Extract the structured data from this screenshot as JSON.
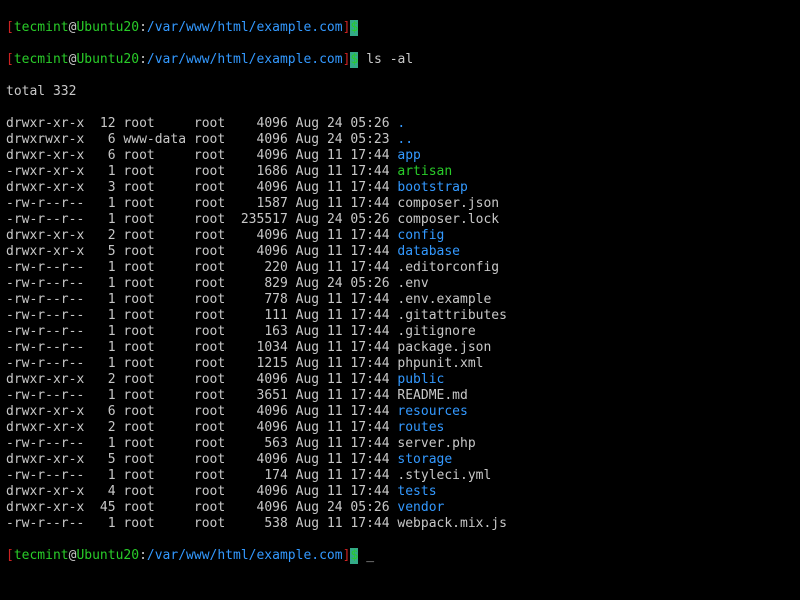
{
  "prompt": {
    "bracket_open": "[",
    "bracket_close": "]",
    "user": "tecmint",
    "at": "@",
    "host": "Ubuntu20",
    "colon": ":",
    "path": "/var/www/html/example.com",
    "dollar": "$"
  },
  "command": "ls -al",
  "total_line": "total 332",
  "files": [
    {
      "perm": "drwxr-xr-x",
      "links": "12",
      "owner": "root",
      "group": "root",
      "size": "4096",
      "date": "Aug 24 05:26",
      "name": ".",
      "cls": "dir"
    },
    {
      "perm": "drwxrwxr-x",
      "links": "6",
      "owner": "www-data",
      "group": "root",
      "size": "4096",
      "date": "Aug 24 05:23",
      "name": "..",
      "cls": "dir"
    },
    {
      "perm": "drwxr-xr-x",
      "links": "6",
      "owner": "root",
      "group": "root",
      "size": "4096",
      "date": "Aug 11 17:44",
      "name": "app",
      "cls": "dir"
    },
    {
      "perm": "-rwxr-xr-x",
      "links": "1",
      "owner": "root",
      "group": "root",
      "size": "1686",
      "date": "Aug 11 17:44",
      "name": "artisan",
      "cls": "exec"
    },
    {
      "perm": "drwxr-xr-x",
      "links": "3",
      "owner": "root",
      "group": "root",
      "size": "4096",
      "date": "Aug 11 17:44",
      "name": "bootstrap",
      "cls": "dir"
    },
    {
      "perm": "-rw-r--r--",
      "links": "1",
      "owner": "root",
      "group": "root",
      "size": "1587",
      "date": "Aug 11 17:44",
      "name": "composer.json",
      "cls": "plain"
    },
    {
      "perm": "-rw-r--r--",
      "links": "1",
      "owner": "root",
      "group": "root",
      "size": "235517",
      "date": "Aug 24 05:26",
      "name": "composer.lock",
      "cls": "plain"
    },
    {
      "perm": "drwxr-xr-x",
      "links": "2",
      "owner": "root",
      "group": "root",
      "size": "4096",
      "date": "Aug 11 17:44",
      "name": "config",
      "cls": "dir"
    },
    {
      "perm": "drwxr-xr-x",
      "links": "5",
      "owner": "root",
      "group": "root",
      "size": "4096",
      "date": "Aug 11 17:44",
      "name": "database",
      "cls": "dir"
    },
    {
      "perm": "-rw-r--r--",
      "links": "1",
      "owner": "root",
      "group": "root",
      "size": "220",
      "date": "Aug 11 17:44",
      "name": ".editorconfig",
      "cls": "plain"
    },
    {
      "perm": "-rw-r--r--",
      "links": "1",
      "owner": "root",
      "group": "root",
      "size": "829",
      "date": "Aug 24 05:26",
      "name": ".env",
      "cls": "plain"
    },
    {
      "perm": "-rw-r--r--",
      "links": "1",
      "owner": "root",
      "group": "root",
      "size": "778",
      "date": "Aug 11 17:44",
      "name": ".env.example",
      "cls": "plain"
    },
    {
      "perm": "-rw-r--r--",
      "links": "1",
      "owner": "root",
      "group": "root",
      "size": "111",
      "date": "Aug 11 17:44",
      "name": ".gitattributes",
      "cls": "plain"
    },
    {
      "perm": "-rw-r--r--",
      "links": "1",
      "owner": "root",
      "group": "root",
      "size": "163",
      "date": "Aug 11 17:44",
      "name": ".gitignore",
      "cls": "plain"
    },
    {
      "perm": "-rw-r--r--",
      "links": "1",
      "owner": "root",
      "group": "root",
      "size": "1034",
      "date": "Aug 11 17:44",
      "name": "package.json",
      "cls": "plain"
    },
    {
      "perm": "-rw-r--r--",
      "links": "1",
      "owner": "root",
      "group": "root",
      "size": "1215",
      "date": "Aug 11 17:44",
      "name": "phpunit.xml",
      "cls": "plain"
    },
    {
      "perm": "drwxr-xr-x",
      "links": "2",
      "owner": "root",
      "group": "root",
      "size": "4096",
      "date": "Aug 11 17:44",
      "name": "public",
      "cls": "dir"
    },
    {
      "perm": "-rw-r--r--",
      "links": "1",
      "owner": "root",
      "group": "root",
      "size": "3651",
      "date": "Aug 11 17:44",
      "name": "README.md",
      "cls": "plain"
    },
    {
      "perm": "drwxr-xr-x",
      "links": "6",
      "owner": "root",
      "group": "root",
      "size": "4096",
      "date": "Aug 11 17:44",
      "name": "resources",
      "cls": "dir"
    },
    {
      "perm": "drwxr-xr-x",
      "links": "2",
      "owner": "root",
      "group": "root",
      "size": "4096",
      "date": "Aug 11 17:44",
      "name": "routes",
      "cls": "dir"
    },
    {
      "perm": "-rw-r--r--",
      "links": "1",
      "owner": "root",
      "group": "root",
      "size": "563",
      "date": "Aug 11 17:44",
      "name": "server.php",
      "cls": "plain"
    },
    {
      "perm": "drwxr-xr-x",
      "links": "5",
      "owner": "root",
      "group": "root",
      "size": "4096",
      "date": "Aug 11 17:44",
      "name": "storage",
      "cls": "dir"
    },
    {
      "perm": "-rw-r--r--",
      "links": "1",
      "owner": "root",
      "group": "root",
      "size": "174",
      "date": "Aug 11 17:44",
      "name": ".styleci.yml",
      "cls": "plain"
    },
    {
      "perm": "drwxr-xr-x",
      "links": "4",
      "owner": "root",
      "group": "root",
      "size": "4096",
      "date": "Aug 11 17:44",
      "name": "tests",
      "cls": "dir"
    },
    {
      "perm": "drwxr-xr-x",
      "links": "45",
      "owner": "root",
      "group": "root",
      "size": "4096",
      "date": "Aug 24 05:26",
      "name": "vendor",
      "cls": "dir"
    },
    {
      "perm": "-rw-r--r--",
      "links": "1",
      "owner": "root",
      "group": "root",
      "size": "538",
      "date": "Aug 11 17:44",
      "name": "webpack.mix.js",
      "cls": "plain"
    }
  ],
  "cursor": "_"
}
